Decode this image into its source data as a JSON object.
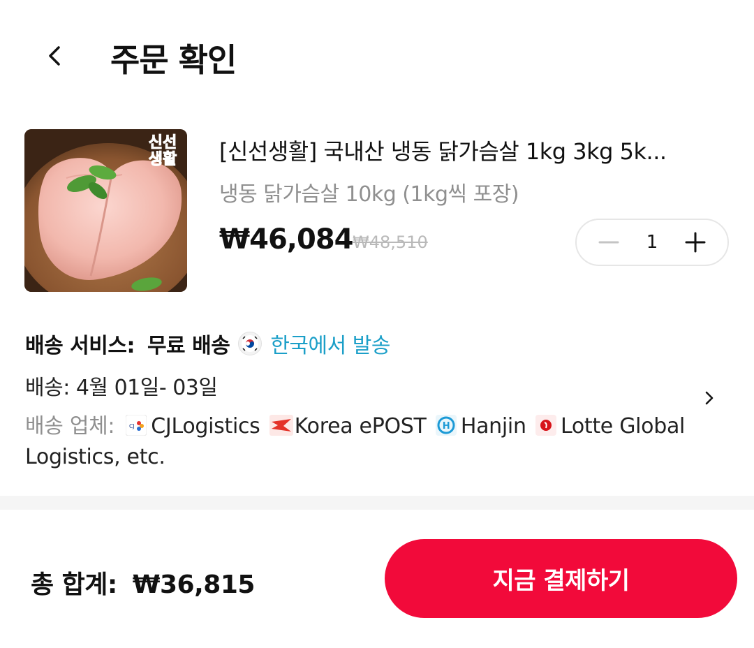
{
  "header": {
    "title": "주문 확인",
    "back_icon": "chevron-left-icon"
  },
  "product": {
    "badge_line1": "신선",
    "badge_line2": "생활",
    "name": "[신선생활] 국내산 냉동 닭가슴살 1kg 3kg 5k...",
    "option": "냉동 닭가슴살 10kg (1kg씩 포장)",
    "price": "₩46,084",
    "original_price": "₩48,510",
    "quantity": "1"
  },
  "shipping": {
    "service_label": "배송 서비스:",
    "service_value": "무료 배송",
    "origin": "한국에서 발송",
    "date": "배송: 4월 01일- 03일",
    "carrier_label": "배송 업체:",
    "carriers": [
      "CJLogistics",
      "Korea ePOST",
      "Hanjin",
      "Lotte Global Logistics, etc."
    ]
  },
  "footer": {
    "total_label": "총 합계:",
    "total_value": "₩36,815",
    "pay_button": "지금 결제하기"
  },
  "colors": {
    "accent": "#f20a3a",
    "origin_link": "#1b9fc8",
    "muted": "#8f8f8f"
  }
}
